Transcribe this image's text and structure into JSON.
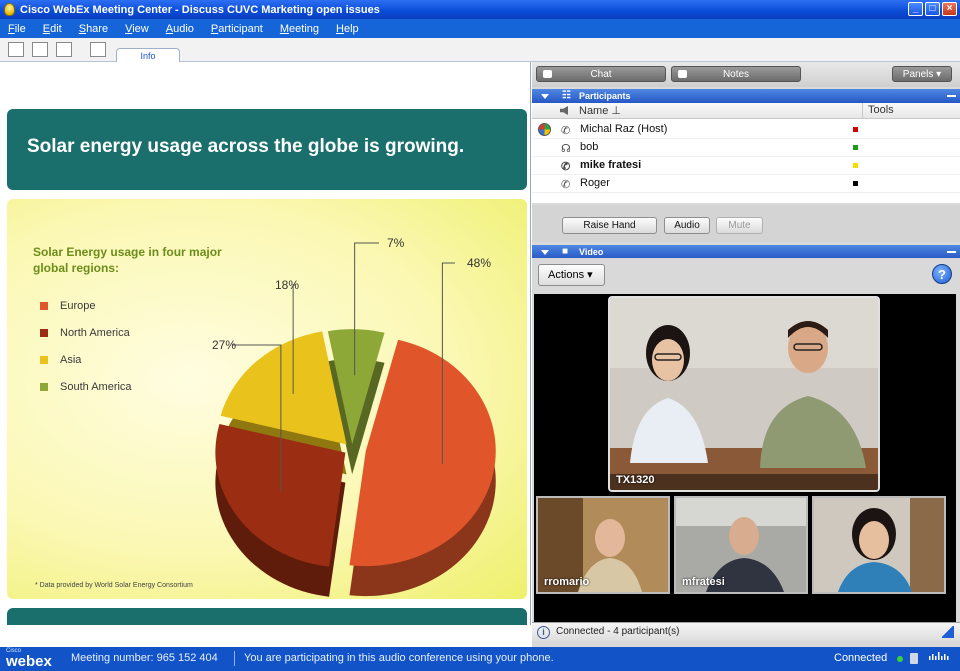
{
  "window": {
    "title": "Cisco WebEx Meeting Center - Discuss CUVC Marketing open issues"
  },
  "menu": {
    "items": [
      {
        "mnemonic": "F",
        "rest": "ile"
      },
      {
        "mnemonic": "E",
        "rest": "dit"
      },
      {
        "mnemonic": "S",
        "rest": "hare"
      },
      {
        "mnemonic": "V",
        "rest": "iew"
      },
      {
        "mnemonic": "A",
        "rest": "udio"
      },
      {
        "mnemonic": "P",
        "rest": "articipant"
      },
      {
        "mnemonic": "M",
        "rest": "eeting"
      },
      {
        "mnemonic": "H",
        "rest": "elp"
      }
    ]
  },
  "tabs": {
    "info": "Info"
  },
  "slide": {
    "title": "Solar energy usage across the globe is growing.",
    "footnote": "* Data provided by World Solar Energy Consortium"
  },
  "chart_data": {
    "type": "pie",
    "title": "Solar Energy usage in four major global regions:",
    "categories": [
      "Europe",
      "North America",
      "Asia",
      "South America"
    ],
    "values": [
      48,
      27,
      18,
      7
    ],
    "value_labels": [
      "48%",
      "27%",
      "18%",
      "7%"
    ],
    "colors": [
      "#e0562a",
      "#9b2d12",
      "#e9c21c",
      "#8ea838"
    ],
    "legend_placement": "left"
  },
  "panel_tabs": {
    "chat": "Chat",
    "notes": "Notes",
    "panels": "Panels"
  },
  "participants": {
    "header": "Participants",
    "col_name": "Name",
    "col_tools": "Tools",
    "rows": [
      {
        "name": "Michal Raz (Host)",
        "color": "#d40000",
        "bold": false
      },
      {
        "name": "bob",
        "color": "#1a9c1a",
        "bold": false
      },
      {
        "name": "mike fratesi",
        "color": "#f0e000",
        "bold": true
      },
      {
        "name": "Roger",
        "color": "#000000",
        "bold": false
      }
    ],
    "buttons": {
      "raise_hand": "Raise Hand",
      "audio": "Audio",
      "mute": "Mute"
    }
  },
  "video": {
    "header": "Video",
    "actions": "Actions",
    "main_label": "TX1320",
    "thumbs": [
      {
        "label": "rromario"
      },
      {
        "label": "mfratesi"
      },
      {
        "label": ""
      }
    ],
    "status": "Connected - 4 participant(s)"
  },
  "statusbar": {
    "logo_small": "Cisco",
    "logo": "webex",
    "meeting": "Meeting number: 965 152 404",
    "audio": "You are participating in this audio conference using your phone.",
    "connected": "Connected"
  }
}
